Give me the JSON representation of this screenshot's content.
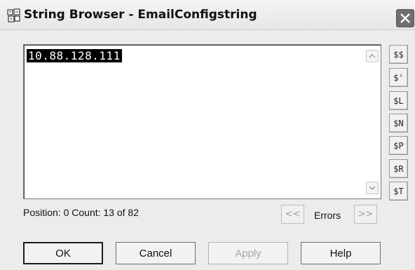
{
  "window": {
    "title": "String Browser - EmailConfigstring",
    "icon": "string-browser-icon",
    "close_icon": "close-icon"
  },
  "editor": {
    "text": "10.88.128.111",
    "selected": true
  },
  "code_buttons": [
    "$$",
    "$'",
    "$L",
    "$N",
    "$P",
    "$R",
    "$T"
  ],
  "status": {
    "text": "Position: 0  Count: 13 of 82"
  },
  "errors": {
    "prev_label": "<<",
    "label": "Errors",
    "next_label": ">>"
  },
  "buttons": {
    "ok": "OK",
    "cancel": "Cancel",
    "apply": "Apply",
    "help": "Help"
  }
}
